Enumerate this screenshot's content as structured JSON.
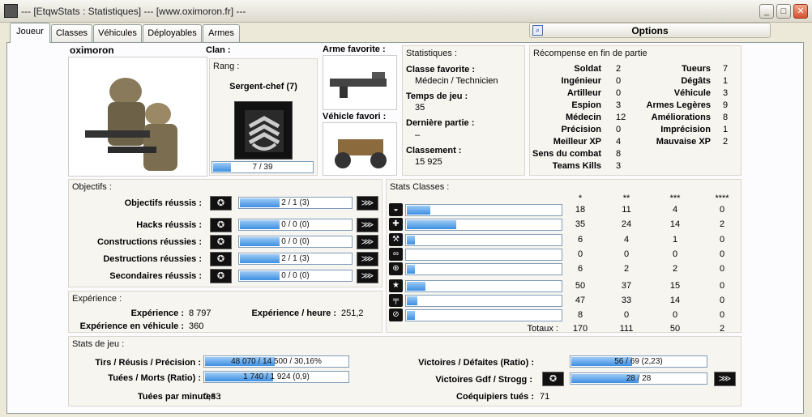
{
  "window": {
    "title": "--- [EtqwStats : Statistiques] --- [www.oximoron.fr] ---",
    "min": "_",
    "max": "□",
    "close": "✕"
  },
  "tabs": [
    "Joueur",
    "Classes",
    "Véhicules",
    "Déployables",
    "Armes"
  ],
  "options": "Options",
  "player": {
    "name": "oximoron"
  },
  "clan": {
    "label": "Clan :",
    "value": ""
  },
  "rank": {
    "header": "Rang :",
    "name": "Sergent-chef (7)",
    "progress": "7 / 39",
    "fraction": 0.18
  },
  "fav": {
    "weapon_label": "Arme favorite :",
    "vehicle_label": "Véhicle favori :"
  },
  "stats": {
    "header": "Statistiques :",
    "fav_class_label": "Classe favorite :",
    "fav_class": "Médecin / Technicien",
    "playtime_label": "Temps de jeu :",
    "playtime": "35",
    "last_label": "Dernière partie :",
    "last": "–",
    "rank_label": "Classement :",
    "rank": "15 925"
  },
  "rewards": {
    "header": "Récompense en fin de partie",
    "left": [
      [
        "Soldat",
        "2"
      ],
      [
        "Ingénieur",
        "0"
      ],
      [
        "Artilleur",
        "0"
      ],
      [
        "Espion",
        "3"
      ],
      [
        "Médecin",
        "12"
      ],
      [
        "Précision",
        "0"
      ],
      [
        "Meilleur XP",
        "4"
      ],
      [
        "Sens du combat",
        "8"
      ],
      [
        "Teams Kills",
        "3"
      ]
    ],
    "right": [
      [
        "Tueurs",
        "7"
      ],
      [
        "Dégâts",
        "1"
      ],
      [
        "Véhicule",
        "3"
      ],
      [
        "Armes Legères",
        "9"
      ],
      [
        "Améliorations",
        "8"
      ],
      [
        "Imprécision",
        "1"
      ],
      [
        "Mauvaise XP",
        "2"
      ]
    ]
  },
  "objectives": {
    "header": "Objectifs :",
    "rows": [
      {
        "label": "Objectifs réussis :",
        "text": "2 / 1 (3)",
        "fraction": 0.35
      },
      {
        "label": "Hacks réussis :",
        "text": "0 / 0 (0)",
        "fraction": 0.35
      },
      {
        "label": "Constructions réussies :",
        "text": "0 / 0 (0)",
        "fraction": 0.35
      },
      {
        "label": "Destructions réussies :",
        "text": "2 / 1 (3)",
        "fraction": 0.35
      },
      {
        "label": "Secondaires réussis :",
        "text": "0 / 0 (0)",
        "fraction": 0.35
      }
    ]
  },
  "experience": {
    "header": "Expérience :",
    "xp_label": "Expérience :",
    "xp": "8 797",
    "xph_label": "Expérience / heure :",
    "xph": "251,2",
    "xpv_label": "Expérience en véhicule :",
    "xpv": "360"
  },
  "class_stats": {
    "header": "Stats Classes :",
    "cols": [
      "*",
      "**",
      "***",
      "****"
    ],
    "rows": [
      {
        "icon": "helmet-icon",
        "glyph": "◒",
        "fraction": 0.15,
        "v": [
          "18",
          "11",
          "4",
          "0"
        ]
      },
      {
        "icon": "medic-cross-icon",
        "glyph": "✚",
        "fraction": 0.32,
        "v": [
          "35",
          "24",
          "14",
          "2"
        ]
      },
      {
        "icon": "wrench-icon",
        "glyph": "⚒",
        "fraction": 0.05,
        "v": [
          "6",
          "4",
          "1",
          "0"
        ]
      },
      {
        "icon": "binoculars-icon",
        "glyph": "∞",
        "fraction": 0.0,
        "v": [
          "0",
          "0",
          "0",
          "0"
        ]
      },
      {
        "icon": "crosshair-icon",
        "glyph": "⊕",
        "fraction": 0.05,
        "v": [
          "6",
          "2",
          "2",
          "0"
        ]
      },
      {
        "icon": "shield-star-icon",
        "glyph": "★",
        "fraction": 0.12,
        "v": [
          "50",
          "37",
          "15",
          "0"
        ]
      },
      {
        "icon": "pistol-icon",
        "glyph": "╤",
        "fraction": 0.07,
        "v": [
          "47",
          "33",
          "14",
          "0"
        ]
      },
      {
        "icon": "no-icon",
        "glyph": "⊘",
        "fraction": 0.05,
        "v": [
          "8",
          "0",
          "0",
          "0"
        ]
      }
    ],
    "totals_label": "Totaux :",
    "totals": [
      "170",
      "111",
      "50",
      "2"
    ]
  },
  "game": {
    "header": "Stats de jeu :",
    "shots_label": "Tirs / Réusis / Précision :",
    "shots": "48 070 / 14 500 / 30,16%",
    "shots_fraction": 0.49,
    "kills_label": "Tuées / Morts (Ratio) :",
    "kills": "1 740 / 1 924 (0,9)",
    "kills_fraction": 0.48,
    "kpm_label": "Tuées par minutes :",
    "kpm": "0,83",
    "wins_label": "Victoires / Défaites (Ratio) :",
    "wins": "56 / 69 (2,23)",
    "wins_fraction": 0.45,
    "gdf_label": "Victoires Gdf / Strogg :",
    "gdf": "28 / 28",
    "gdf_fraction": 0.5,
    "tk_label": "Coéquipiers tués :",
    "tk": "71"
  }
}
